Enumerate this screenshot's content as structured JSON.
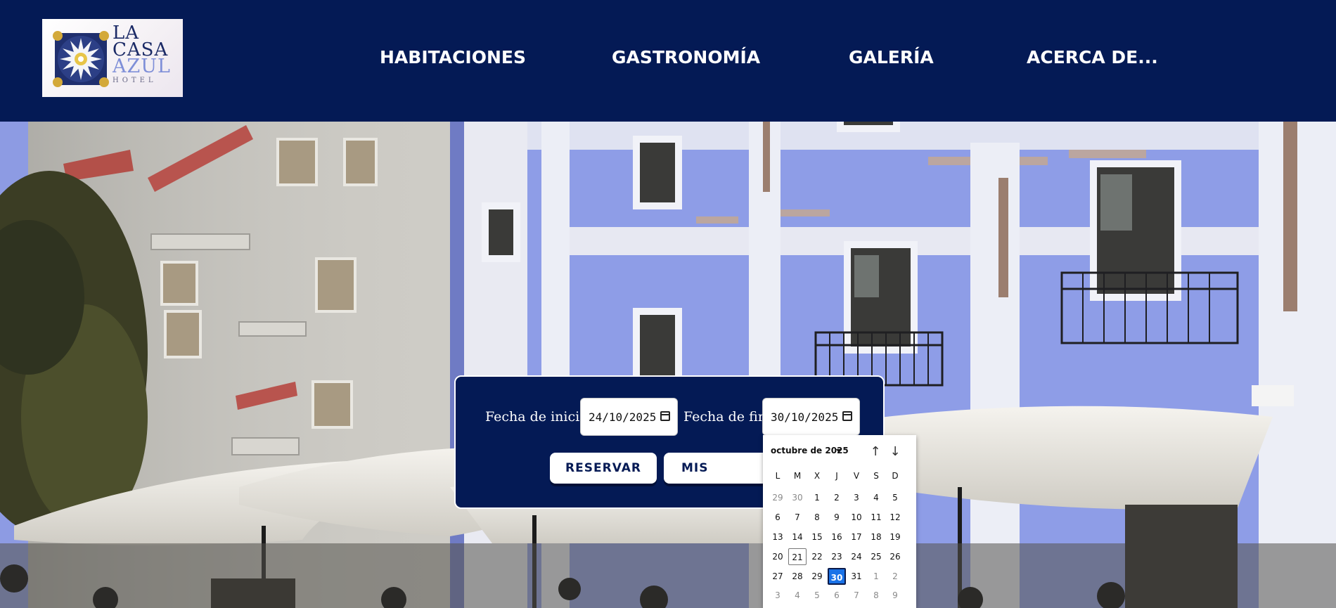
{
  "header": {
    "logo": {
      "line1": "LA",
      "line2": "CASA",
      "line3": "AZUL",
      "line4": "HOTEL"
    },
    "nav": [
      {
        "label": "HABITACIONES"
      },
      {
        "label": "GASTRONOMÍA"
      },
      {
        "label": "GALERÍA"
      },
      {
        "label": "ACERCA DE..."
      }
    ]
  },
  "booking": {
    "start_label": "Fecha de inicio:",
    "start_value": "24/10/2025",
    "end_label": "Fecha de fin:",
    "end_value": "30/10/2025",
    "reserve_label": "RESERVAR",
    "my_reservations_label": "MIS RESERVAS"
  },
  "datepicker": {
    "month_label": "octubre de 2025",
    "weekdays": [
      "L",
      "M",
      "X",
      "J",
      "V",
      "S",
      "D"
    ],
    "weeks": [
      [
        "29",
        "30",
        "1",
        "2",
        "3",
        "4",
        "5"
      ],
      [
        "6",
        "7",
        "8",
        "9",
        "10",
        "11",
        "12"
      ],
      [
        "13",
        "14",
        "15",
        "16",
        "17",
        "18",
        "19"
      ],
      [
        "20",
        "21",
        "22",
        "23",
        "24",
        "25",
        "26"
      ],
      [
        "27",
        "28",
        "29",
        "30",
        "31",
        "1",
        "2"
      ],
      [
        "3",
        "4",
        "5",
        "6",
        "7",
        "8",
        "9"
      ]
    ],
    "today": "21",
    "selected": "30"
  },
  "colors": {
    "navy": "#041a55",
    "facade_blue": "#8c9be6",
    "selected_day": "#1a73e8"
  }
}
